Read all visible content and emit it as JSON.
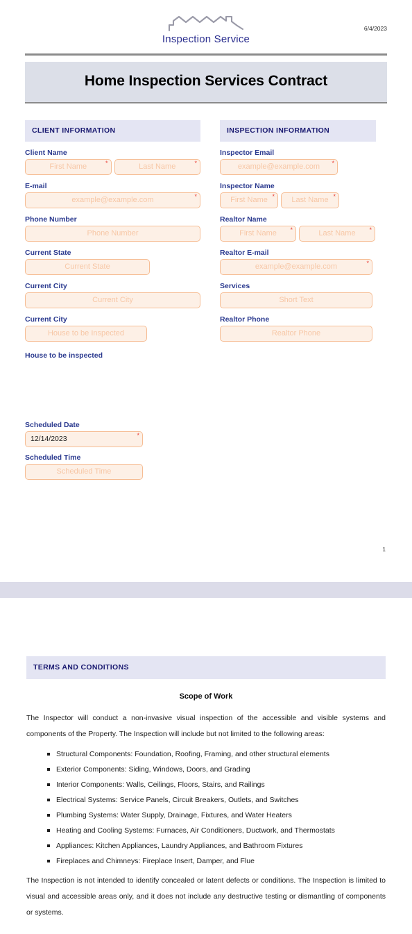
{
  "header": {
    "date": "6/4/2023",
    "logo_text": "Inspection Service",
    "logo_icon": "houses-roofline-icon"
  },
  "title": "Home Inspection Services Contract",
  "client_section": {
    "heading": "CLIENT INFORMATION",
    "fields": {
      "client_name_label": "Client Name",
      "first_name_placeholder": "First Name",
      "last_name_placeholder": "Last Name",
      "email_label": "E-mail",
      "email_placeholder": "example@example.com",
      "phone_label": "Phone Number",
      "phone_placeholder": "Phone Number",
      "state_label": "Current State",
      "state_placeholder": "Current State",
      "city_label": "Current City",
      "city_placeholder": "Current City",
      "city2_label": "Current City",
      "house_placeholder": "House to be Inspected",
      "house_label": "House to be inspected"
    }
  },
  "inspection_section": {
    "heading": "INSPECTION INFORMATION",
    "fields": {
      "inspector_email_label": "Inspector Email",
      "inspector_email_placeholder": "example@example.com",
      "inspector_name_label": "Inspector Name",
      "inspector_first_placeholder": "First Name",
      "inspector_last_placeholder": "Last Name",
      "realtor_name_label": "Realtor Name",
      "realtor_first_placeholder": "First Name",
      "realtor_last_placeholder": "Last Name",
      "realtor_email_label": "Realtor E-mail",
      "realtor_email_placeholder": "example@example.com",
      "services_label": "Services",
      "services_placeholder": "Short Text",
      "realtor_phone_label": "Realtor Phone",
      "realtor_phone_placeholder": "Realtor Phone"
    }
  },
  "schedule": {
    "date_label": "Scheduled Date",
    "date_value": "12/14/2023",
    "time_label": "Scheduled Time",
    "time_placeholder": "Scheduled Time"
  },
  "page_number": "1",
  "terms": {
    "heading": "TERMS AND CONDITIONS",
    "subheading": "Scope of Work",
    "intro": "The Inspector will conduct a non-invasive visual inspection of the accessible and visible systems and components of the Property. The Inspection will include but not limited to the following areas:",
    "areas": [
      "Structural Components: Foundation, Roofing, Framing, and other structural elements",
      "Exterior Components: Siding, Windows, Doors, and Grading",
      "Interior Components: Walls, Ceilings, Floors, Stairs, and Railings",
      "Electrical Systems: Service Panels, Circuit Breakers, Outlets, and Switches",
      "Plumbing Systems: Water Supply, Drainage, Fixtures, and Water Heaters",
      "Heating and Cooling Systems: Furnaces, Air Conditioners, Ductwork, and Thermostats",
      "Appliances: Kitchen Appliances, Laundry Appliances, and Bathroom Fixtures",
      "Fireplaces and Chimneys: Fireplace Insert, Damper, and Flue"
    ],
    "closing": "The Inspection is not intended to identify concealed or latent defects or conditions. The Inspection is limited to visual and accessible areas only, and it does not include any destructive testing or dismantling of components or systems."
  },
  "colors": {
    "title_banner_bg": "#dcdfe8",
    "section_head_bg": "#e4e5f3",
    "section_head_text": "#191970",
    "label_text": "#2b3a8f",
    "input_bg": "#fdf0e6",
    "input_border": "#f6bd94",
    "placeholder_text": "#f7c7a6",
    "required_marker": "#e8403a",
    "page_gap": "#dcdce9",
    "rule": "#8b8b8b"
  }
}
